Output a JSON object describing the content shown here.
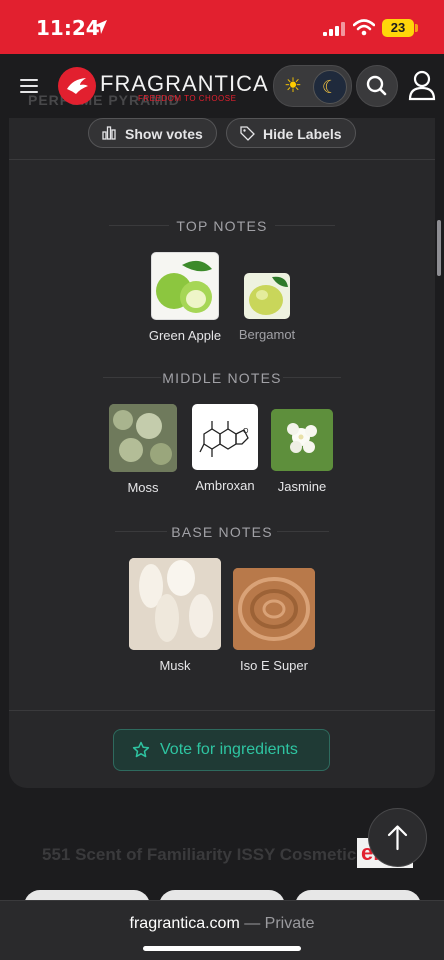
{
  "status_bar": {
    "time": "11:24",
    "battery": "23"
  },
  "nav": {
    "brand": "FRAGRANTICA",
    "brand_tagline": "FREEDOM TO CHOOSE",
    "behind_title": "PERFUME PYRAMID"
  },
  "pyramid": {
    "show_votes_label": "Show votes",
    "hide_labels_label": "Hide Labels",
    "top": {
      "title": "TOP NOTES",
      "notes": [
        {
          "name": "Green Apple"
        },
        {
          "name": "Bergamot"
        }
      ]
    },
    "middle": {
      "title": "MIDDLE NOTES",
      "notes": [
        {
          "name": "Moss"
        },
        {
          "name": "Ambroxan"
        },
        {
          "name": "Jasmine"
        }
      ]
    },
    "base": {
      "title": "BASE NOTES",
      "notes": [
        {
          "name": "Musk"
        },
        {
          "name": "Iso E Super"
        }
      ]
    },
    "vote_button_label": "Vote for ingredients"
  },
  "below": {
    "product_text": "551 Scent of Familiarity ISSY Cosmetics",
    "shop_logo": "eb"
  },
  "browser": {
    "domain": "fragrantica.com",
    "separator": " — ",
    "mode": "Private"
  },
  "colors": {
    "brand_red": "#e2202f",
    "accent_teal": "#2ec4a1",
    "card_bg": "#28282a"
  }
}
